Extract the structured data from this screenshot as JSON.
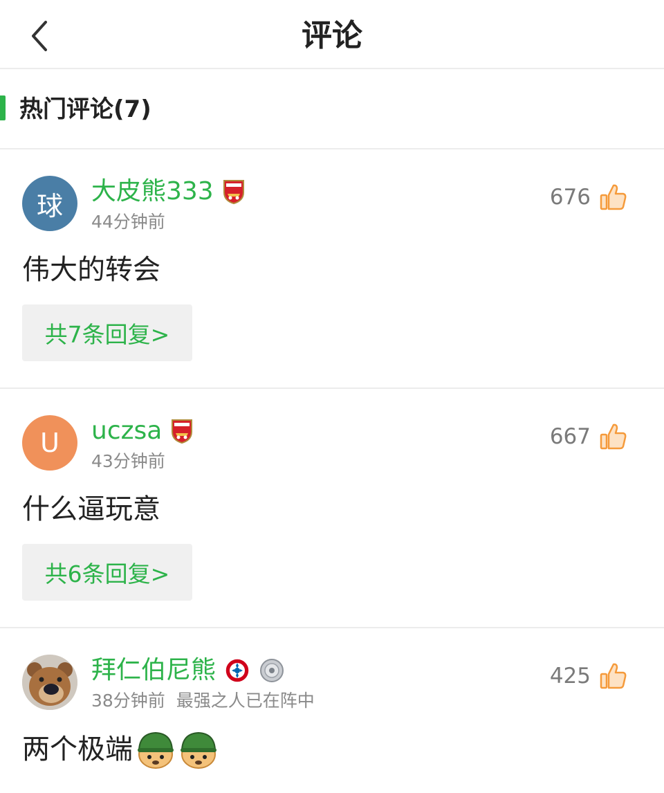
{
  "header": {
    "title": "评论",
    "back_icon": "chevron-left-icon"
  },
  "section": {
    "title": "热门评论(7)",
    "accent_color": "#2db34a"
  },
  "comments": [
    {
      "avatar_text": "球",
      "avatar_color": "#4a7ea6",
      "username": "大皮熊333",
      "badges": [
        "arsenal-badge-icon"
      ],
      "time": "44分钟前",
      "extra": "",
      "likes": "676",
      "content": "伟大的转会",
      "emojis": [],
      "reply_label": "共7条回复>"
    },
    {
      "avatar_text": "U",
      "avatar_color": "#f0915a",
      "username": "uczsa",
      "badges": [
        "arsenal-badge-icon"
      ],
      "time": "43分钟前",
      "extra": "",
      "likes": "667",
      "content": "什么逼玩意",
      "emojis": [],
      "reply_label": "共6条回复>"
    },
    {
      "avatar_text": "",
      "avatar_color": "#8a6a4a",
      "username": "拜仁伯尼熊",
      "badges": [
        "bayern-badge-icon",
        "trophy-plate-icon"
      ],
      "time": "38分钟前",
      "extra": "最强之人已在阵中",
      "likes": "425",
      "content": "两个极端",
      "emojis": [
        "helmet-doge-emoji",
        "helmet-doge-emoji"
      ],
      "reply_label": ""
    }
  ],
  "colors": {
    "green": "#2db34a",
    "like_orange": "#f59a3a",
    "meta_gray": "#8a8a8a"
  }
}
